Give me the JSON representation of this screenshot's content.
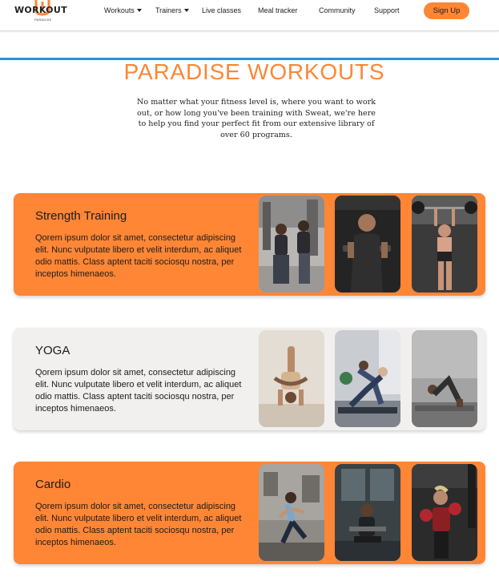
{
  "logo": {
    "name": "WORKOUT",
    "sub": "PARADISE"
  },
  "nav": {
    "items": [
      {
        "label": "Workouts",
        "dropdown": true
      },
      {
        "label": "Trainers",
        "dropdown": true
      },
      {
        "label": "Live classes",
        "dropdown": false
      },
      {
        "label": "Meal tracker",
        "dropdown": false
      },
      {
        "label": "Community",
        "dropdown": false
      },
      {
        "label": "Support",
        "dropdown": false
      }
    ],
    "signup_label": "Sign Up"
  },
  "colors": {
    "accent": "#ff8635",
    "divider": "#2a8fde",
    "card_grey": "#f1f0ee"
  },
  "hero": {
    "title": "PARADISE WORKOUTS",
    "text": "No matter what your fitness level is, where you want to work out, or how long you've been training with Sweat, we're here to help you find your perfect fit from our extensive library of over 60 programs."
  },
  "cards": [
    {
      "title": "Strength Training",
      "text": "Qorem ipsum dolor sit amet, consectetur adipiscing elit. Nunc vulputate libero et velit interdum, ac aliquet odio mattis. Class aptent taciti sociosqu nostra, per inceptos himenaeos.",
      "photos": [
        "gym-women-machines-photo",
        "man-dumbbells-photo",
        "woman-barbell-photo"
      ]
    },
    {
      "title": "YOGA",
      "text": "Qorem ipsum dolor sit amet, consectetur adipiscing elit. Nunc vulputate libero et velit interdum, ac aliquet odio mattis. Class aptent taciti sociosqu nostra, per inceptos himenaeos.",
      "photos": [
        "headstand-yoga-photo",
        "partner-yoga-photo",
        "yoga-stretch-photo"
      ]
    },
    {
      "title": "Cardio",
      "text": "Qorem ipsum dolor sit amet, consectetur adipiscing elit. Nunc vulputate libero et velit interdum, ac aliquet odio mattis. Class aptent taciti sociosqu nostra, per inceptos himenaeos.",
      "photos": [
        "street-running-photo",
        "man-rowing-photo",
        "boxing-photo"
      ]
    }
  ]
}
